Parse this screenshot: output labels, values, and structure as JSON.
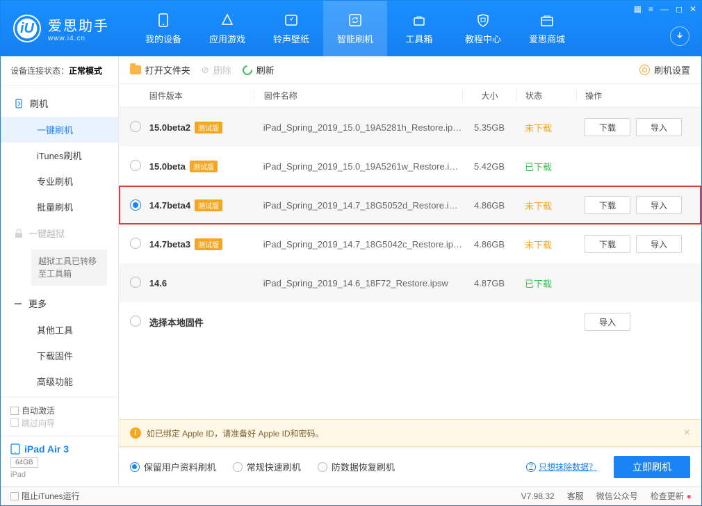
{
  "brand": {
    "name": "爱思助手",
    "site": "www.i4.cn",
    "logo_letter": "iU"
  },
  "wincontrols": [
    "▦",
    "≡",
    "—",
    "◻",
    "✕"
  ],
  "nav": [
    {
      "label": "我的设备"
    },
    {
      "label": "应用游戏"
    },
    {
      "label": "铃声壁纸"
    },
    {
      "label": "智能刷机",
      "active": true
    },
    {
      "label": "工具箱"
    },
    {
      "label": "教程中心"
    },
    {
      "label": "爱思商城"
    }
  ],
  "sidebar": {
    "status_label": "设备连接状态：",
    "status_value": "正常模式",
    "sec_flash": "刷机",
    "items_flash": [
      "一键刷机",
      "iTunes刷机",
      "专业刷机",
      "批量刷机"
    ],
    "sec_jail": "一键越狱",
    "jail_note": "越狱工具已转移至工具箱",
    "sec_more": "更多",
    "items_more": [
      "其他工具",
      "下载固件",
      "高级功能"
    ],
    "auto_activate": "自动激活",
    "skip_guide": "跳过向导",
    "device_name": "iPad Air 3",
    "device_cap": "64GB",
    "device_type": "iPad"
  },
  "toolbar": {
    "open_folder": "打开文件夹",
    "delete": "删除",
    "refresh": "刷新",
    "settings": "刷机设置"
  },
  "columns": {
    "version": "固件版本",
    "name": "固件名称",
    "size": "大小",
    "status": "状态",
    "ops": "操作"
  },
  "badge_beta": "测试版",
  "status_labels": {
    "not_downloaded": "未下载",
    "downloaded": "已下载"
  },
  "op_labels": {
    "download": "下载",
    "import": "导入"
  },
  "choose_local": "选择本地固件",
  "rows": [
    {
      "version": "15.0beta2",
      "beta": true,
      "name": "iPad_Spring_2019_15.0_19A5281h_Restore.ip…",
      "size": "5.35GB",
      "status": "not_downloaded",
      "selected": false,
      "can_download": true
    },
    {
      "version": "15.0beta",
      "beta": true,
      "name": "iPad_Spring_2019_15.0_19A5261w_Restore.i…",
      "size": "5.42GB",
      "status": "downloaded",
      "selected": false,
      "can_download": false
    },
    {
      "version": "14.7beta4",
      "beta": true,
      "name": "iPad_Spring_2019_14.7_18G5052d_Restore.i…",
      "size": "4.86GB",
      "status": "not_downloaded",
      "selected": true,
      "can_download": true,
      "highlight": true
    },
    {
      "version": "14.7beta3",
      "beta": true,
      "name": "iPad_Spring_2019_14.7_18G5042c_Restore.ip…",
      "size": "4.86GB",
      "status": "not_downloaded",
      "selected": false,
      "can_download": true
    },
    {
      "version": "14.6",
      "beta": false,
      "name": "iPad_Spring_2019_14.6_18F72_Restore.ipsw",
      "size": "4.87GB",
      "status": "downloaded",
      "selected": false,
      "can_download": false
    }
  ],
  "alert": "如已绑定 Apple ID，请准备好 Apple ID和密码。",
  "flash_options": [
    "保留用户资料刷机",
    "常规快速刷机",
    "防数据恢复刷机"
  ],
  "erase_link": "只想抹除数据？",
  "flash_now": "立即刷机",
  "footer": {
    "block_itunes": "阻止iTunes运行",
    "version": "V7.98.32",
    "cs": "客服",
    "wechat": "微信公众号",
    "update": "检查更新"
  }
}
